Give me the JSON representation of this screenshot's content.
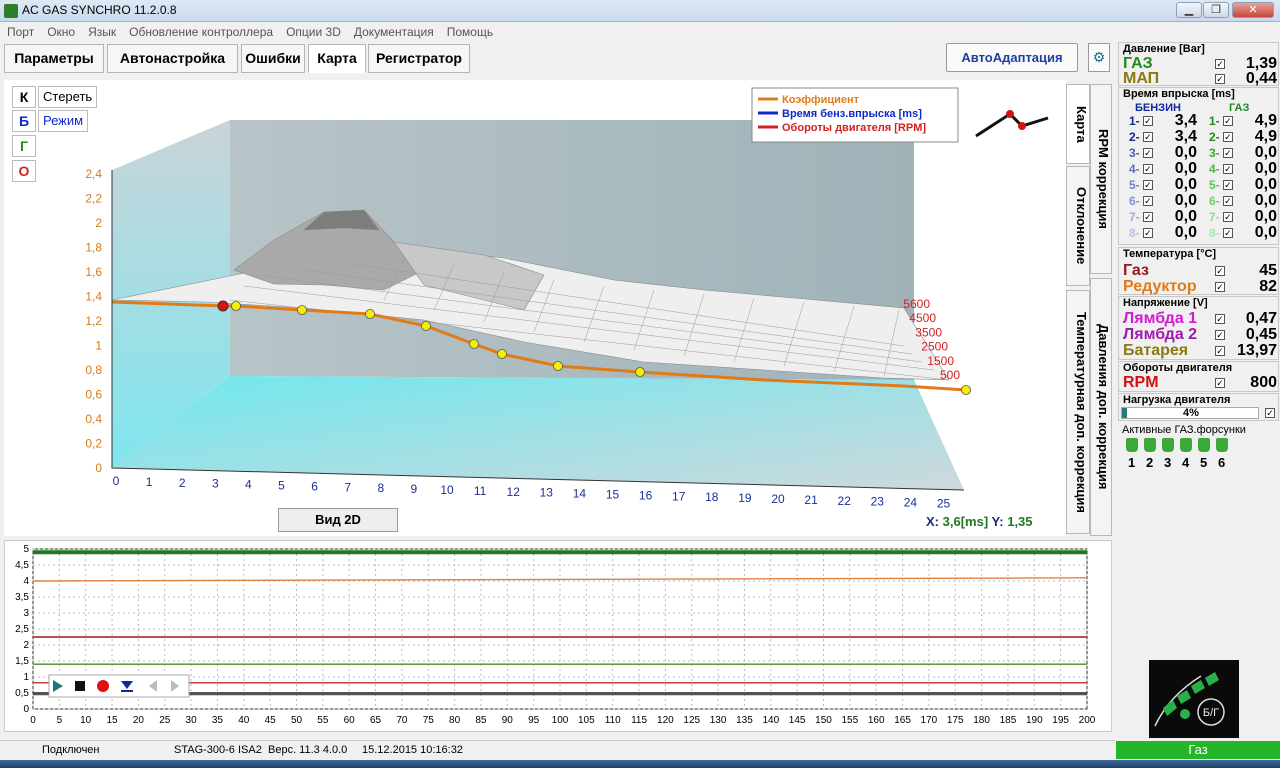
{
  "window": {
    "title": "AC GAS SYNCHRO  11.2.0.8"
  },
  "menu": [
    "Порт",
    "Окно",
    "Язык",
    "Обновление контроллера",
    "Опции 3D",
    "Документация",
    "Помощь"
  ],
  "tabs": [
    "Параметры",
    "Автонастройка",
    "Ошибки",
    "Карта",
    "Регистратор"
  ],
  "auto_btn": "АвтоАдаптация",
  "left_buttons": {
    "k": "К",
    "b": "Б",
    "g": "Г",
    "o": "О",
    "clear": "Стереть",
    "mode": "Режим"
  },
  "legend": [
    {
      "label": "Коэффициент",
      "color": "#e07b1a"
    },
    {
      "label": "Время бенз.впрыска [ms]",
      "color": "#1028c8"
    },
    {
      "label": "Обороты двигателя [RPM]",
      "color": "#d42020"
    }
  ],
  "side_tabs": [
    "Карта",
    "RPM коррекция",
    "Отклонение",
    "Температурная доп. коррекция",
    "Давления доп. коррекция"
  ],
  "vid2d": "Вид 2D",
  "cursor": {
    "x_label": "X:",
    "x_val": "3,6[ms]",
    "y_label": "Y:",
    "y_val": "1,35"
  },
  "map_chart": {
    "y_ticks": [
      "0",
      "0,2",
      "0,4",
      "0,6",
      "0,8",
      "1",
      "1,2",
      "1,4",
      "1,6",
      "1,8",
      "2",
      "2,2",
      "2,4"
    ],
    "x_ticks": [
      "0",
      "1",
      "2",
      "3",
      "4",
      "5",
      "6",
      "7",
      "8",
      "9",
      "10",
      "11",
      "12",
      "13",
      "14",
      "15",
      "16",
      "17",
      "18",
      "19",
      "20",
      "21",
      "22",
      "23",
      "24",
      "25"
    ],
    "rpm_ticks": [
      "5600",
      "4500",
      "3500",
      "2500",
      "1500",
      "500"
    ]
  },
  "chart_data": {
    "type": "line",
    "xlabel": "",
    "ylabel": "",
    "x_ticks": [
      "0",
      "5",
      "10",
      "15",
      "20",
      "25",
      "30",
      "35",
      "40",
      "45",
      "50",
      "55",
      "60",
      "65",
      "70",
      "75",
      "80",
      "85",
      "90",
      "95",
      "100",
      "105",
      "110",
      "115",
      "120",
      "125",
      "130",
      "135",
      "140",
      "145",
      "150",
      "155",
      "160",
      "165",
      "170",
      "175",
      "180",
      "185",
      "190",
      "195",
      "200"
    ],
    "y_ticks": [
      "0",
      "0,5",
      "1",
      "1,5",
      "2",
      "2,5",
      "3",
      "3,5",
      "4",
      "4,5",
      "5"
    ],
    "xlim": [
      0,
      200
    ],
    "ylim": [
      0,
      5
    ],
    "series": [
      {
        "color": "#1f7a1f",
        "values": [
          4.9,
          4.9
        ]
      },
      {
        "color": "#e08040",
        "values": [
          4.0,
          4.05,
          4.1
        ]
      },
      {
        "color": "#a01818",
        "values": [
          2.25,
          2.25
        ]
      },
      {
        "color": "#4a8a2a",
        "values": [
          1.4,
          1.4
        ]
      },
      {
        "color": "#c04040",
        "values": [
          0.82,
          0.82
        ]
      },
      {
        "color": "#202020",
        "values": [
          0.5,
          0.5
        ]
      },
      {
        "color": "#555555",
        "values": [
          0.45,
          0.45
        ]
      }
    ]
  },
  "status": {
    "connected": "Подключен",
    "device": "STAG-300-6 ISA2",
    "ver": "Верс. 11.3  4.0.0",
    "datetime": "15.12.2015 10:16:32",
    "mode": "Газ"
  },
  "panel": {
    "pressure": {
      "header": "Давление  [Bar]",
      "gas_label": "ГАЗ",
      "gas": "1,39",
      "map_label": "МАП",
      "map": "0,44"
    },
    "inj": {
      "header": "Время впрыска [ms]",
      "benz": "БЕНЗИН",
      "gas": "ГАЗ",
      "rows": [
        {
          "n": "1-",
          "b": "3,4",
          "gn": "1-",
          "g": "4,9"
        },
        {
          "n": "2-",
          "b": "3,4",
          "gn": "2-",
          "g": "4,9"
        },
        {
          "n": "3-",
          "b": "0,0",
          "gn": "3-",
          "g": "0,0"
        },
        {
          "n": "4-",
          "b": "0,0",
          "gn": "4-",
          "g": "0,0"
        },
        {
          "n": "5-",
          "b": "0,0",
          "gn": "5-",
          "g": "0,0"
        },
        {
          "n": "6-",
          "b": "0,0",
          "gn": "6-",
          "g": "0,0"
        },
        {
          "n": "7-",
          "b": "0,0",
          "gn": "7-",
          "g": "0,0"
        },
        {
          "n": "8-",
          "b": "0,0",
          "gn": "8-",
          "g": "0,0"
        }
      ]
    },
    "temp": {
      "header": "Температура  [°C]",
      "gas_label": "Газ",
      "gas": "45",
      "red_label": "Редуктор",
      "red": "82"
    },
    "volt": {
      "header": "Напряжение [V]",
      "l1_label": "Лямбда 1",
      "l1": "0,47",
      "l2_label": "Лямбда 2",
      "l2": "0,45",
      "bat_label": "Батарея",
      "bat": "13,97"
    },
    "rpm": {
      "header": "Обороты двигателя",
      "label": "RPM",
      "val": "800"
    },
    "load": {
      "header": "Нагрузка двигателя",
      "val": "4%",
      "fraction": 0.04
    },
    "injectors": {
      "header": "Активные ГАЗ.форсунки",
      "nums": [
        "1",
        "2",
        "3",
        "4",
        "5",
        "6"
      ]
    },
    "switch_label": "Б/Г"
  }
}
